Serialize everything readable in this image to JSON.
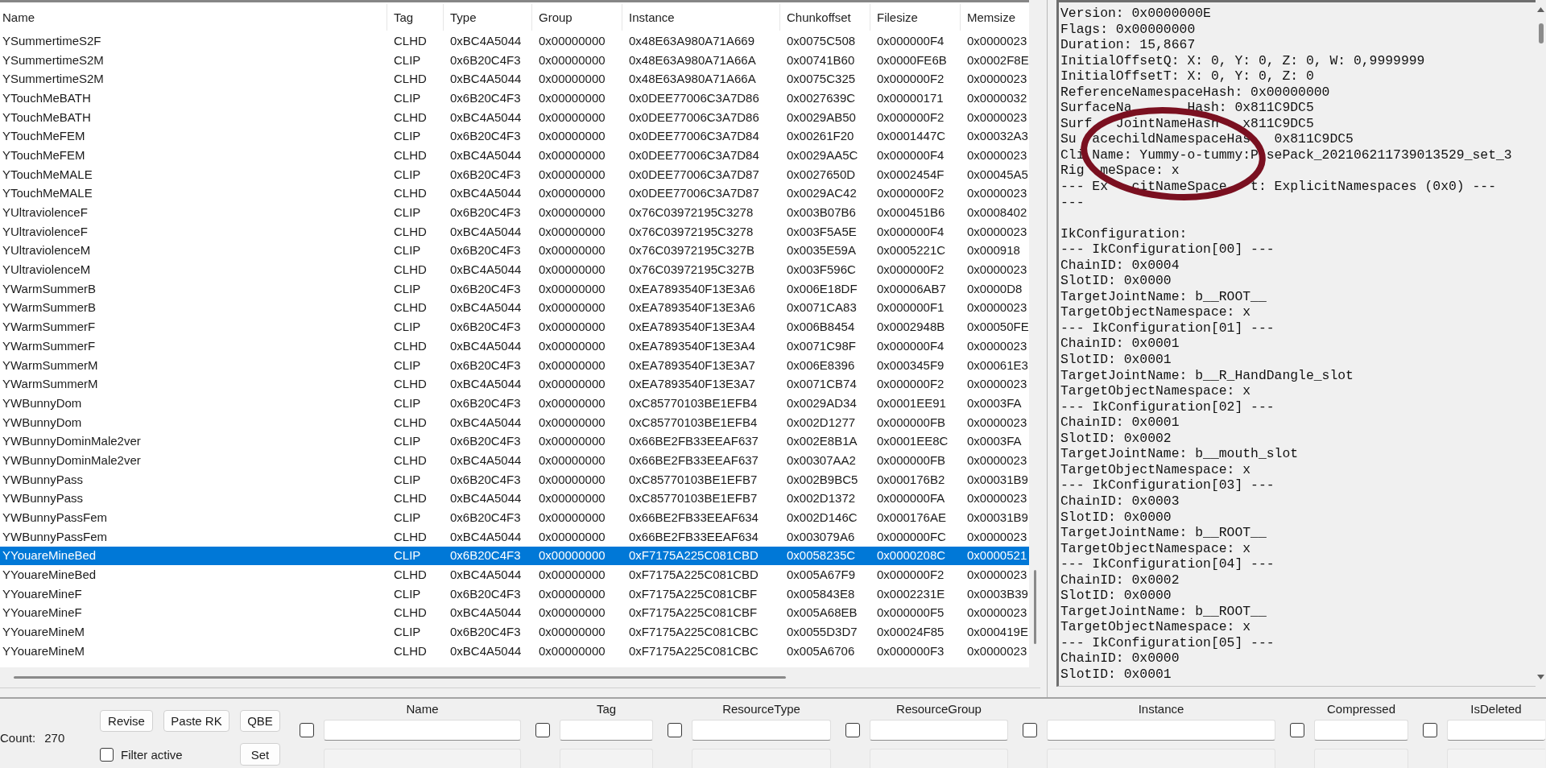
{
  "table": {
    "columns": [
      "Name",
      "Tag",
      "Type",
      "Group",
      "Instance",
      "Chunkoffset",
      "Filesize",
      "Memsize"
    ],
    "rows": [
      {
        "cells": [
          "YSummertimeS2F",
          "CLHD",
          "0xBC4A5044",
          "0x00000000",
          "0x48E63A980A71A669",
          "0x0075C508",
          "0x000000F4",
          "0x0000023"
        ],
        "selected": false
      },
      {
        "cells": [
          "YSummertimeS2M",
          "CLIP",
          "0x6B20C4F3",
          "0x00000000",
          "0x48E63A980A71A66A",
          "0x00741B60",
          "0x0000FE6B",
          "0x0002F8E"
        ],
        "selected": false
      },
      {
        "cells": [
          "YSummertimeS2M",
          "CLHD",
          "0xBC4A5044",
          "0x00000000",
          "0x48E63A980A71A66A",
          "0x0075C325",
          "0x000000F2",
          "0x0000023"
        ],
        "selected": false
      },
      {
        "cells": [
          "YTouchMeBATH",
          "CLIP",
          "0x6B20C4F3",
          "0x00000000",
          "0x0DEE77006C3A7D86",
          "0x0027639C",
          "0x00000171",
          "0x0000032"
        ],
        "selected": false
      },
      {
        "cells": [
          "YTouchMeBATH",
          "CLHD",
          "0xBC4A5044",
          "0x00000000",
          "0x0DEE77006C3A7D86",
          "0x0029AB50",
          "0x000000F2",
          "0x0000023"
        ],
        "selected": false
      },
      {
        "cells": [
          "YTouchMeFEM",
          "CLIP",
          "0x6B20C4F3",
          "0x00000000",
          "0x0DEE77006C3A7D84",
          "0x00261F20",
          "0x0001447C",
          "0x00032A3"
        ],
        "selected": false
      },
      {
        "cells": [
          "YTouchMeFEM",
          "CLHD",
          "0xBC4A5044",
          "0x00000000",
          "0x0DEE77006C3A7D84",
          "0x0029AA5C",
          "0x000000F4",
          "0x0000023"
        ],
        "selected": false
      },
      {
        "cells": [
          "YTouchMeMALE",
          "CLIP",
          "0x6B20C4F3",
          "0x00000000",
          "0x0DEE77006C3A7D87",
          "0x0027650D",
          "0x0002454F",
          "0x00045A5"
        ],
        "selected": false
      },
      {
        "cells": [
          "YTouchMeMALE",
          "CLHD",
          "0xBC4A5044",
          "0x00000000",
          "0x0DEE77006C3A7D87",
          "0x0029AC42",
          "0x000000F2",
          "0x0000023"
        ],
        "selected": false
      },
      {
        "cells": [
          "YUltraviolenceF",
          "CLIP",
          "0x6B20C4F3",
          "0x00000000",
          "0x76C03972195C3278",
          "0x003B07B6",
          "0x000451B6",
          "0x0008402"
        ],
        "selected": false
      },
      {
        "cells": [
          "YUltraviolenceF",
          "CLHD",
          "0xBC4A5044",
          "0x00000000",
          "0x76C03972195C3278",
          "0x003F5A5E",
          "0x000000F4",
          "0x0000023"
        ],
        "selected": false
      },
      {
        "cells": [
          "YUltraviolenceM",
          "CLIP",
          "0x6B20C4F3",
          "0x00000000",
          "0x76C03972195C327B",
          "0x0035E59A",
          "0x0005221C",
          "0x000918"
        ],
        "selected": false
      },
      {
        "cells": [
          "YUltraviolenceM",
          "CLHD",
          "0xBC4A5044",
          "0x00000000",
          "0x76C03972195C327B",
          "0x003F596C",
          "0x000000F2",
          "0x0000023"
        ],
        "selected": false
      },
      {
        "cells": [
          "YWarmSummerB",
          "CLIP",
          "0x6B20C4F3",
          "0x00000000",
          "0xEA7893540F13E3A6",
          "0x006E18DF",
          "0x00006AB7",
          "0x0000D8"
        ],
        "selected": false
      },
      {
        "cells": [
          "YWarmSummerB",
          "CLHD",
          "0xBC4A5044",
          "0x00000000",
          "0xEA7893540F13E3A6",
          "0x0071CA83",
          "0x000000F1",
          "0x0000023"
        ],
        "selected": false
      },
      {
        "cells": [
          "YWarmSummerF",
          "CLIP",
          "0x6B20C4F3",
          "0x00000000",
          "0xEA7893540F13E3A4",
          "0x006B8454",
          "0x0002948B",
          "0x00050FE"
        ],
        "selected": false
      },
      {
        "cells": [
          "YWarmSummerF",
          "CLHD",
          "0xBC4A5044",
          "0x00000000",
          "0xEA7893540F13E3A4",
          "0x0071C98F",
          "0x000000F4",
          "0x0000023"
        ],
        "selected": false
      },
      {
        "cells": [
          "YWarmSummerM",
          "CLIP",
          "0x6B20C4F3",
          "0x00000000",
          "0xEA7893540F13E3A7",
          "0x006E8396",
          "0x000345F9",
          "0x00061E3"
        ],
        "selected": false
      },
      {
        "cells": [
          "YWarmSummerM",
          "CLHD",
          "0xBC4A5044",
          "0x00000000",
          "0xEA7893540F13E3A7",
          "0x0071CB74",
          "0x000000F2",
          "0x0000023"
        ],
        "selected": false
      },
      {
        "cells": [
          "YWBunnyDom",
          "CLIP",
          "0x6B20C4F3",
          "0x00000000",
          "0xC85770103BE1EFB4",
          "0x0029AD34",
          "0x0001EE91",
          "0x0003FA"
        ],
        "selected": false
      },
      {
        "cells": [
          "YWBunnyDom",
          "CLHD",
          "0xBC4A5044",
          "0x00000000",
          "0xC85770103BE1EFB4",
          "0x002D1277",
          "0x000000FB",
          "0x0000023"
        ],
        "selected": false
      },
      {
        "cells": [
          "YWBunnyDominMale2ver",
          "CLIP",
          "0x6B20C4F3",
          "0x00000000",
          "0x66BE2FB33EEAF637",
          "0x002E8B1A",
          "0x0001EE8C",
          "0x0003FA"
        ],
        "selected": false
      },
      {
        "cells": [
          "YWBunnyDominMale2ver",
          "CLHD",
          "0xBC4A5044",
          "0x00000000",
          "0x66BE2FB33EEAF637",
          "0x00307AA2",
          "0x000000FB",
          "0x0000023"
        ],
        "selected": false
      },
      {
        "cells": [
          "YWBunnyPass",
          "CLIP",
          "0x6B20C4F3",
          "0x00000000",
          "0xC85770103BE1EFB7",
          "0x002B9BC5",
          "0x000176B2",
          "0x00031B9"
        ],
        "selected": false
      },
      {
        "cells": [
          "YWBunnyPass",
          "CLHD",
          "0xBC4A5044",
          "0x00000000",
          "0xC85770103BE1EFB7",
          "0x002D1372",
          "0x000000FA",
          "0x0000023"
        ],
        "selected": false
      },
      {
        "cells": [
          "YWBunnyPassFem",
          "CLIP",
          "0x6B20C4F3",
          "0x00000000",
          "0x66BE2FB33EEAF634",
          "0x002D146C",
          "0x000176AE",
          "0x00031B9"
        ],
        "selected": false
      },
      {
        "cells": [
          "YWBunnyPassFem",
          "CLHD",
          "0xBC4A5044",
          "0x00000000",
          "0x66BE2FB33EEAF634",
          "0x003079A6",
          "0x000000FC",
          "0x0000023"
        ],
        "selected": false
      },
      {
        "cells": [
          "YYouareMineBed",
          "CLIP",
          "0x6B20C4F3",
          "0x00000000",
          "0xF7175A225C081CBD",
          "0x0058235C",
          "0x0000208C",
          "0x0000521"
        ],
        "selected": true
      },
      {
        "cells": [
          "YYouareMineBed",
          "CLHD",
          "0xBC4A5044",
          "0x00000000",
          "0xF7175A225C081CBD",
          "0x005A67F9",
          "0x000000F2",
          "0x0000023"
        ],
        "selected": false
      },
      {
        "cells": [
          "YYouareMineF",
          "CLIP",
          "0x6B20C4F3",
          "0x00000000",
          "0xF7175A225C081CBF",
          "0x005843E8",
          "0x0002231E",
          "0x0003B39"
        ],
        "selected": false
      },
      {
        "cells": [
          "YYouareMineF",
          "CLHD",
          "0xBC4A5044",
          "0x00000000",
          "0xF7175A225C081CBF",
          "0x005A68EB",
          "0x000000F5",
          "0x0000023"
        ],
        "selected": false
      },
      {
        "cells": [
          "YYouareMineM",
          "CLIP",
          "0x6B20C4F3",
          "0x00000000",
          "0xF7175A225C081CBC",
          "0x0055D3D7",
          "0x00024F85",
          "0x000419E"
        ],
        "selected": false
      },
      {
        "cells": [
          "YYouareMineM",
          "CLHD",
          "0xBC4A5044",
          "0x00000000",
          "0xF7175A225C081CBC",
          "0x005A6706",
          "0x000000F3",
          "0x0000023"
        ],
        "selected": false
      }
    ]
  },
  "details": {
    "blocks": [
      [
        "Version: 0x0000000E",
        "Flags: 0x00000000",
        "Duration: 15,8667",
        "InitialOffsetQ: X: 0, Y: 0, Z: 0, W: 0,9999999",
        "InitialOffsetT: X: 0, Y: 0, Z: 0",
        "ReferenceNamespaceHash: 0x00000000",
        "SurfaceNa       Hash: 0x811C9DC5",
        "Surf   JointNameHash   x811C9DC5",
        "Su  acechildNamespaceHas   0x811C9DC5",
        "Cli Name: Yummy-o-tummy:P sePack_202106211739013529_set_3",
        "Rig  meSpace: x",
        "--- Ex   citNameSpace   t: ExplicitNamespaces (0x0) ---",
        "---"
      ],
      [
        "IkConfiguration:",
        "--- IkConfiguration[00] ---",
        "ChainID: 0x0004",
        "SlotID: 0x0000",
        "TargetJointName: b__ROOT__",
        "TargetObjectNamespace: x",
        "--- IkConfiguration[01] ---",
        "ChainID: 0x0001",
        "SlotID: 0x0001",
        "TargetJointName: b__R_HandDangle_slot",
        "TargetObjectNamespace: x",
        "--- IkConfiguration[02] ---",
        "ChainID: 0x0001",
        "SlotID: 0x0002",
        "TargetJointName: b__mouth_slot",
        "TargetObjectNamespace: x",
        "--- IkConfiguration[03] ---",
        "ChainID: 0x0003",
        "SlotID: 0x0000",
        "TargetJointName: b__ROOT__",
        "TargetObjectNamespace: x",
        "--- IkConfiguration[04] ---",
        "ChainID: 0x0002",
        "SlotID: 0x0000",
        "TargetJointName: b__ROOT__",
        "TargetObjectNamespace: x",
        "--- IkConfiguration[05] ---",
        "ChainID: 0x0000",
        "SlotID: 0x0001"
      ]
    ]
  },
  "bottom_panel": {
    "count_label": "Count:",
    "count_value": "270",
    "buttons": [
      "Revise",
      "Paste RK",
      "QBE"
    ],
    "filter_active": {
      "label": "Filter active",
      "checked": false
    },
    "set_button": "Set",
    "filters": [
      {
        "label": "Name",
        "checked": false,
        "second_field_disabled": true
      },
      {
        "label": "Tag",
        "checked": false,
        "second_field_disabled": true
      },
      {
        "label": "ResourceType",
        "checked": false,
        "second_field_disabled": true
      },
      {
        "label": "ResourceGroup",
        "checked": false,
        "second_field_disabled": true
      },
      {
        "label": "Instance",
        "checked": false,
        "second_field_disabled": true
      },
      {
        "label": "Compressed",
        "checked": false,
        "second_field_disabled": true
      },
      {
        "label": "IsDeleted",
        "checked": false,
        "second_field_disabled": true
      }
    ]
  }
}
